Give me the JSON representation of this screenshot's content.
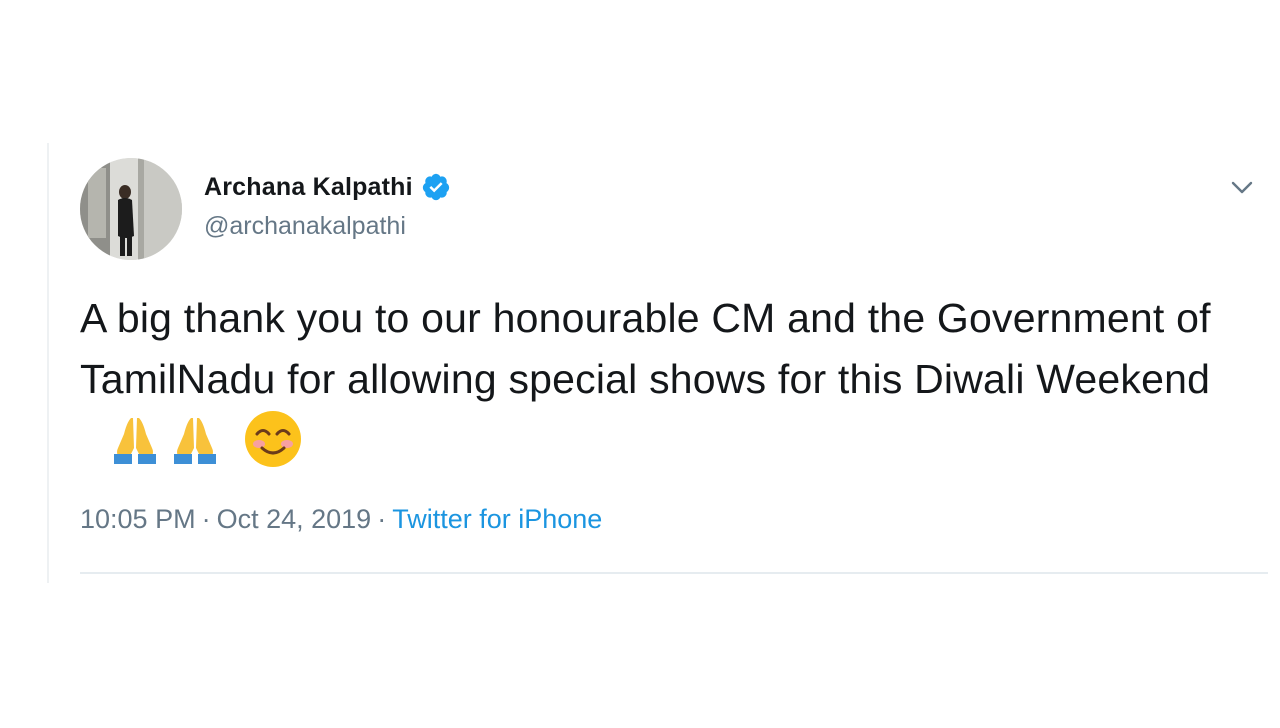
{
  "tweet": {
    "author": {
      "display_name": "Archana Kalpathi",
      "handle": "@archanakalpathi",
      "verified": true
    },
    "text": "A big thank you to our honourable CM and the Government of TamilNadu for allowing special shows for this Diwali Weekend",
    "emojis": [
      "folded-hands-icon",
      "folded-hands-icon",
      "smiling-face-icon"
    ],
    "time": "10:05 PM",
    "date": "Oct 24, 2019",
    "separator": "·",
    "source": "Twitter for iPhone"
  },
  "colors": {
    "text": "#14171a",
    "secondary": "#657786",
    "accent": "#1b95e0",
    "verified": "#1da1f2"
  },
  "icons": {
    "verified": "verified-badge-icon",
    "menu": "chevron-down-icon"
  }
}
